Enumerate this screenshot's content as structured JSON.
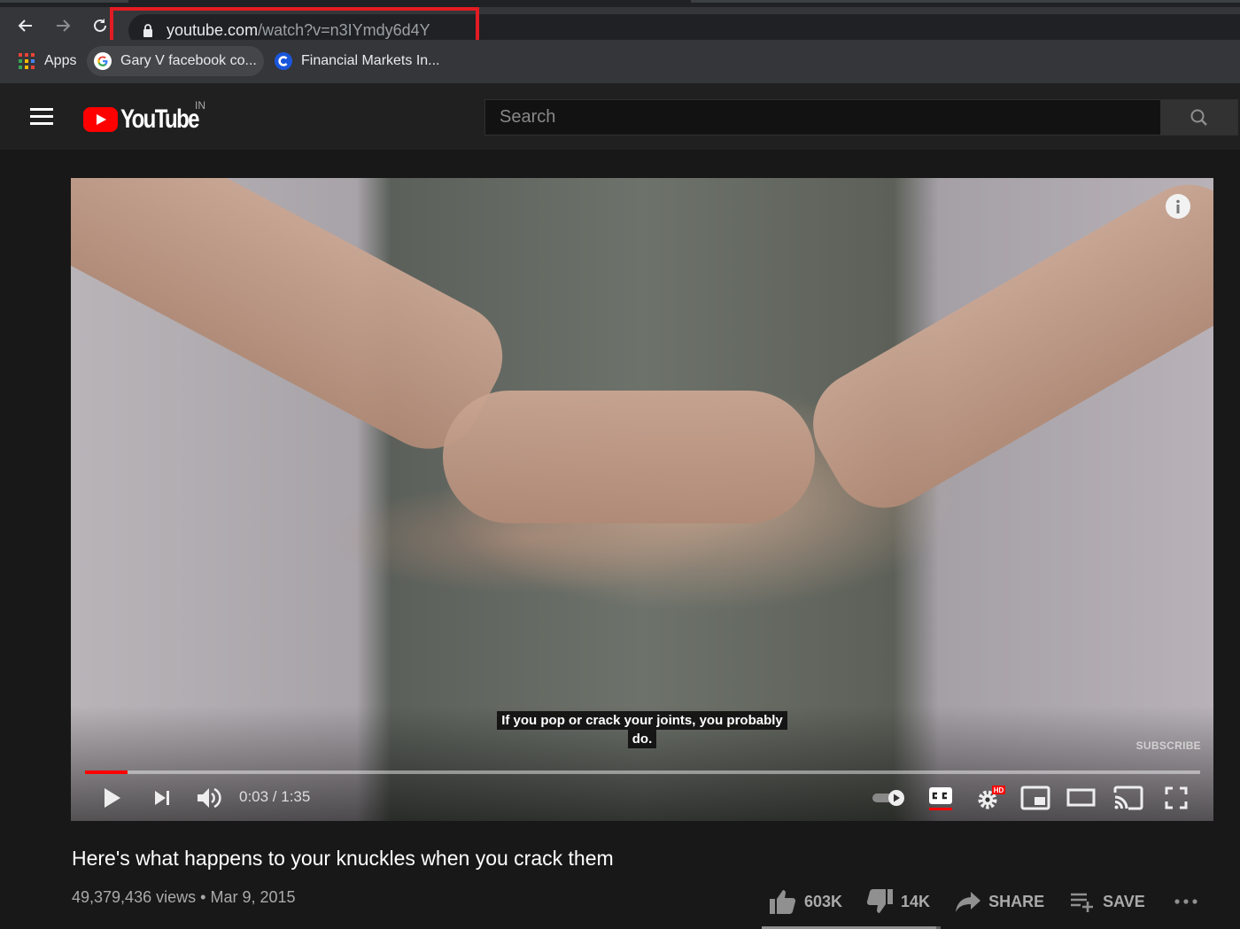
{
  "browser": {
    "url_host": "youtube.com",
    "url_path": "/watch?v=n3IYmdy6d4Y",
    "highlight_color": "#e31c23",
    "bookmarks": [
      {
        "label": "Apps",
        "icon": "apps-grid-icon"
      },
      {
        "label": "Gary V facebook co...",
        "icon": "google-icon"
      },
      {
        "label": "Financial Markets In...",
        "icon": "c-logo-icon"
      }
    ]
  },
  "header": {
    "logo_text": "YouTube",
    "region": "IN",
    "search_placeholder": "Search",
    "brand_color": "#ff0000"
  },
  "player": {
    "caption_line1": "If you pop or crack your joints, you probably",
    "caption_line2": "do.",
    "subscribe_watermark": "SUBSCRIBE",
    "current_time": "0:03",
    "duration": "1:35",
    "time_display": "0:03 / 1:35",
    "progress_fraction": 0.038,
    "autoplay": "on",
    "captions_enabled": true,
    "quality_badge": "HD"
  },
  "video": {
    "title": "Here's what happens to your knuckles when you crack them",
    "views": "49,379,436 views",
    "separator": "•",
    "date": "Mar 9, 2015",
    "likes": "603K",
    "dislikes": "14K",
    "share_label": "SHARE",
    "save_label": "SAVE",
    "like_ratio": 0.977
  }
}
